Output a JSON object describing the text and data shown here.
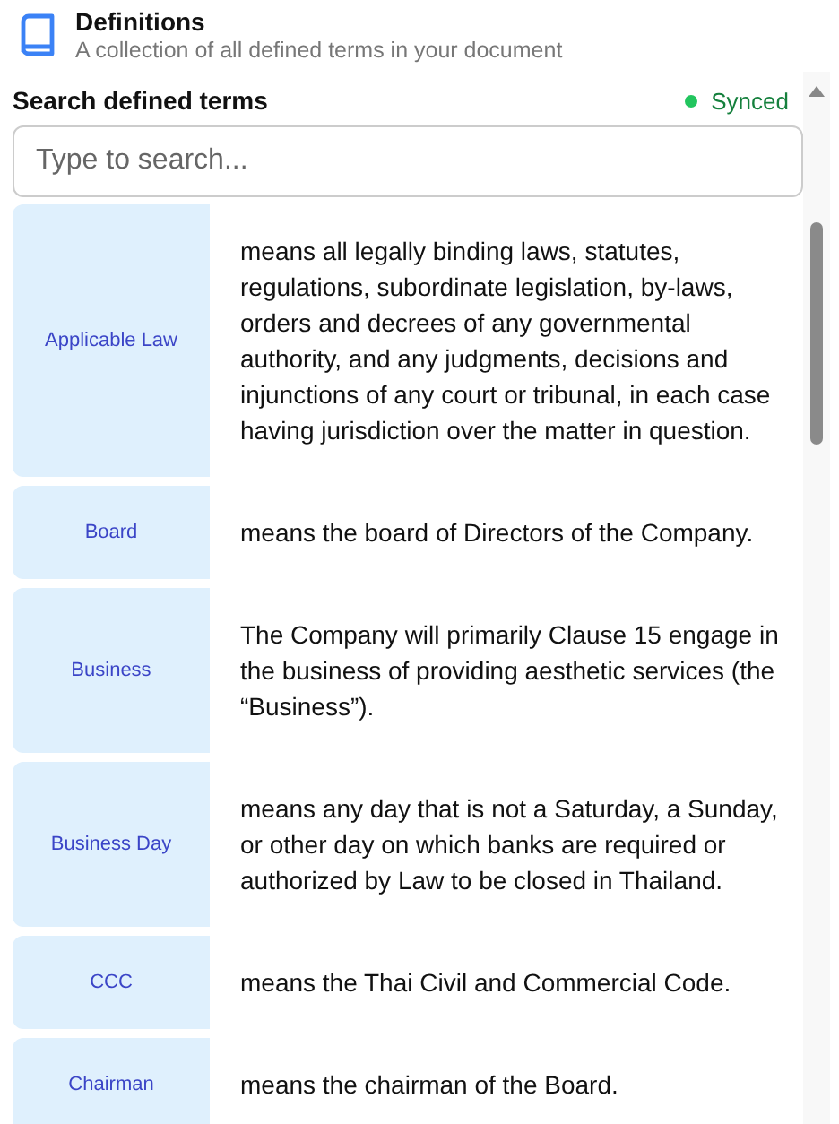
{
  "header": {
    "title": "Definitions",
    "subtitle": "A collection of all defined terms in your document"
  },
  "search": {
    "label": "Search defined terms",
    "status": {
      "text": "Synced",
      "color": "#22c55e"
    },
    "placeholder": "Type to search..."
  },
  "definitions": [
    {
      "term": "Applicable Law",
      "meaning": "means all legally binding laws, statutes, regulations, subordinate legislation, by-laws, orders and decrees of any governmental authority, and any judgments, decisions and injunctions of any court or tribunal, in each case having jurisdiction over the matter in question."
    },
    {
      "term": "Board",
      "meaning": "means the board of Directors of the Company."
    },
    {
      "term": "Business",
      "meaning": "The Company will primarily Clause 15 engage in the business of providing aesthetic services (the “Business”)."
    },
    {
      "term": "Business Day",
      "meaning": "means any day that is not a Saturday, a Sunday, or other day on which banks are required or authorized by Law to be closed in Thailand."
    },
    {
      "term": "CCC",
      "meaning": "means the Thai Civil and Commercial Code."
    },
    {
      "term": "Chairman",
      "meaning": "means the chairman of the Board."
    }
  ]
}
